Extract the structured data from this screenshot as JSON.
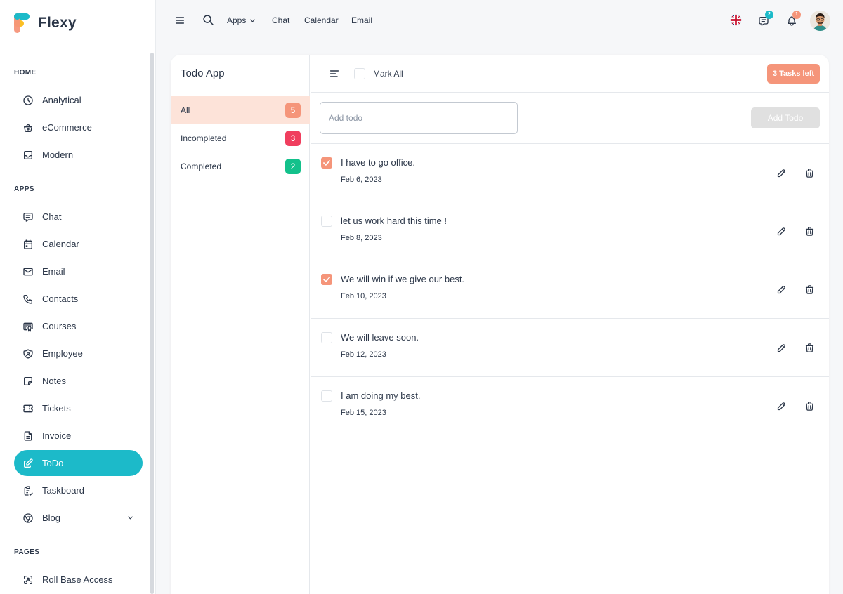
{
  "brand": {
    "name": "Flexy"
  },
  "sidebar": {
    "sections": {
      "home": "HOME",
      "apps": "APPS",
      "pages": "PAGES"
    },
    "items": [
      {
        "label": "Analytical",
        "icon": "pie-chart-icon"
      },
      {
        "label": "eCommerce",
        "icon": "basket-icon"
      },
      {
        "label": "Modern",
        "icon": "inbox-icon"
      },
      {
        "label": "Chat",
        "icon": "message-icon"
      },
      {
        "label": "Calendar",
        "icon": "calendar-icon"
      },
      {
        "label": "Email",
        "icon": "mail-icon"
      },
      {
        "label": "Contacts",
        "icon": "phone-icon"
      },
      {
        "label": "Courses",
        "icon": "certificate-icon"
      },
      {
        "label": "Employee",
        "icon": "shield-icon"
      },
      {
        "label": "Notes",
        "icon": "note-icon"
      },
      {
        "label": "Tickets",
        "icon": "ticket-icon"
      },
      {
        "label": "Invoice",
        "icon": "file-text-icon"
      },
      {
        "label": "ToDo",
        "icon": "edit-icon",
        "active": true
      },
      {
        "label": "Taskboard",
        "icon": "clipboard-icon"
      },
      {
        "label": "Blog",
        "icon": "chrome-icon"
      },
      {
        "label": "Roll Base Access",
        "icon": "scan-face-icon"
      }
    ]
  },
  "topbar": {
    "links": [
      "Apps",
      "Chat",
      "Calendar",
      "Email"
    ],
    "messages_count": "2",
    "notifications_count": "1"
  },
  "todo_app": {
    "title": "Todo App",
    "filters": [
      {
        "label": "All",
        "count": "5",
        "color": "#f5957a",
        "active": true
      },
      {
        "label": "Incompleted",
        "count": "3",
        "color": "#f03e5e"
      },
      {
        "label": "Completed",
        "count": "2",
        "color": "#13c18b"
      }
    ],
    "mark_all_label": "Mark All",
    "tasks_left": "3 Tasks left",
    "add_placeholder": "Add todo",
    "add_button": "Add Todo",
    "todos": [
      {
        "text": "I have to go office.",
        "date": "Feb 6, 2023",
        "done": true
      },
      {
        "text": "let us work hard this time !",
        "date": "Feb 8, 2023",
        "done": false
      },
      {
        "text": "We will win if we give our best.",
        "date": "Feb 10, 2023",
        "done": true
      },
      {
        "text": "We will leave soon.",
        "date": "Feb 12, 2023",
        "done": false
      },
      {
        "text": "I am doing my best.",
        "date": "Feb 15, 2023",
        "done": false
      }
    ]
  },
  "colors": {
    "accent": "#1cbac9",
    "orange": "#f5957a",
    "red": "#f03e5e",
    "green": "#13c18b"
  }
}
